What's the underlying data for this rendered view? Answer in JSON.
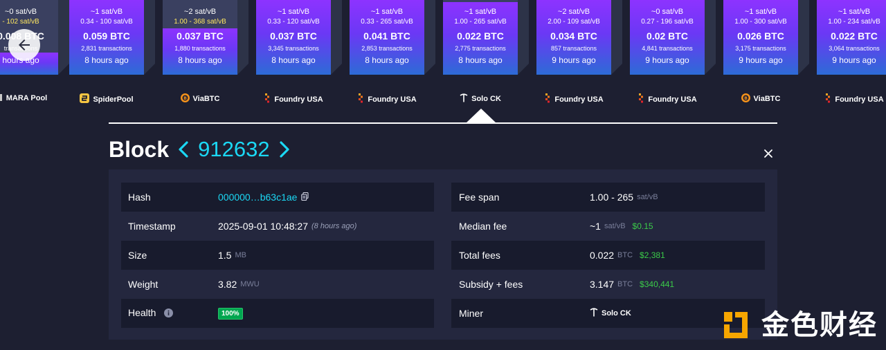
{
  "colors": {
    "accent": "#1bd8f4",
    "background": "#1d1f31",
    "panel": "#24273e",
    "fill_gradient_top": "#8d33ff",
    "fill_gradient_bottom": "#2d6bd6",
    "fiat_green": "#3bcc49",
    "badge_green": "#00a650"
  },
  "chain": {
    "blocks": [
      {
        "fee_rate": "~0 sat/vB",
        "fee_range": "- 102 sat/vB",
        "total": "0.008 BTC",
        "tx_count": "transactions",
        "age": "hours ago",
        "pool": "MARA Pool",
        "pool_icon": "mara-icon",
        "fill_level": 0.3
      },
      {
        "fee_rate": "~1 sat/vB",
        "fee_range": "0.34 - 100 sat/vB",
        "total": "0.059 BTC",
        "tx_count": "2,831 transactions",
        "age": "8 hours ago",
        "pool": "SpiderPool",
        "pool_icon": "spiderpool-icon",
        "fill_level": 1.0
      },
      {
        "fee_rate": "~2 sat/vB",
        "fee_range": "1.00 - 368 sat/vB",
        "total": "0.037 BTC",
        "tx_count": "1,880 transactions",
        "age": "8 hours ago",
        "pool": "ViaBTC",
        "pool_icon": "viabtc-icon",
        "fill_level": 0.62
      },
      {
        "fee_rate": "~1 sat/vB",
        "fee_range": "0.33 - 120 sat/vB",
        "total": "0.037 BTC",
        "tx_count": "3,345 transactions",
        "age": "8 hours ago",
        "pool": "Foundry USA",
        "pool_icon": "foundry-icon",
        "fill_level": 1.0
      },
      {
        "fee_rate": "~1 sat/vB",
        "fee_range": "0.33 - 265 sat/vB",
        "total": "0.041 BTC",
        "tx_count": "2,853 transactions",
        "age": "8 hours ago",
        "pool": "Foundry USA",
        "pool_icon": "foundry-icon",
        "fill_level": 1.0
      },
      {
        "fee_rate": "~1 sat/vB",
        "fee_range": "1.00 - 265 sat/vB",
        "total": "0.022 BTC",
        "tx_count": "2,775 transactions",
        "age": "8 hours ago",
        "pool": "Solo CK",
        "pool_icon": "pickaxe-icon",
        "fill_level": 0.97
      },
      {
        "fee_rate": "~2 sat/vB",
        "fee_range": "2.00 - 109 sat/vB",
        "total": "0.034 BTC",
        "tx_count": "857 transactions",
        "age": "9 hours ago",
        "pool": "Foundry USA",
        "pool_icon": "foundry-icon",
        "fill_level": 1.0
      },
      {
        "fee_rate": "~0 sat/vB",
        "fee_range": "0.27 - 196 sat/vB",
        "total": "0.02 BTC",
        "tx_count": "4,841 transactions",
        "age": "9 hours ago",
        "pool": "Foundry USA",
        "pool_icon": "foundry-icon",
        "fill_level": 1.0
      },
      {
        "fee_rate": "~1 sat/vB",
        "fee_range": "1.00 - 300 sat/vB",
        "total": "0.026 BTC",
        "tx_count": "3,175 transactions",
        "age": "9 hours ago",
        "pool": "ViaBTC",
        "pool_icon": "viabtc-icon",
        "fill_level": 1.0
      },
      {
        "fee_rate": "~1 sat/vB",
        "fee_range": "1.00 - 234 sat/vB",
        "total": "0.022 BTC",
        "tx_count": "3,064 transactions",
        "age": "9 hours ago",
        "pool": "Foundry USA",
        "pool_icon": "foundry-icon",
        "fill_level": 1.0
      }
    ]
  },
  "heading": {
    "label": "Block",
    "height": "912632",
    "prev_icon": "chevron-left-icon",
    "next_icon": "chevron-right-icon",
    "close_icon": "close-icon"
  },
  "details": {
    "left": [
      {
        "key": "Hash",
        "value": "000000…b63c1ae"
      },
      {
        "key": "Timestamp",
        "value": "2025-09-01 10:48:27",
        "note": "(8 hours ago)"
      },
      {
        "key": "Size",
        "value": "1.5",
        "unit": "MB"
      },
      {
        "key": "Weight",
        "value": "3.82",
        "unit": "MWU"
      },
      {
        "key": "Health",
        "value": "100%"
      }
    ],
    "right": [
      {
        "key": "Fee span",
        "value": "1.00 - 265",
        "unit": "sat/vB"
      },
      {
        "key": "Median fee",
        "value": "~1",
        "unit": "sat/vB",
        "fiat": "$0.15"
      },
      {
        "key": "Total fees",
        "value": "0.022",
        "unit": "BTC",
        "fiat": "$2,381"
      },
      {
        "key": "Subsidy + fees",
        "value": "3.147",
        "unit": "BTC",
        "fiat": "$340,441"
      },
      {
        "key": "Miner",
        "value": "Solo CK"
      }
    ]
  },
  "watermark": {
    "text": "金色财经"
  }
}
